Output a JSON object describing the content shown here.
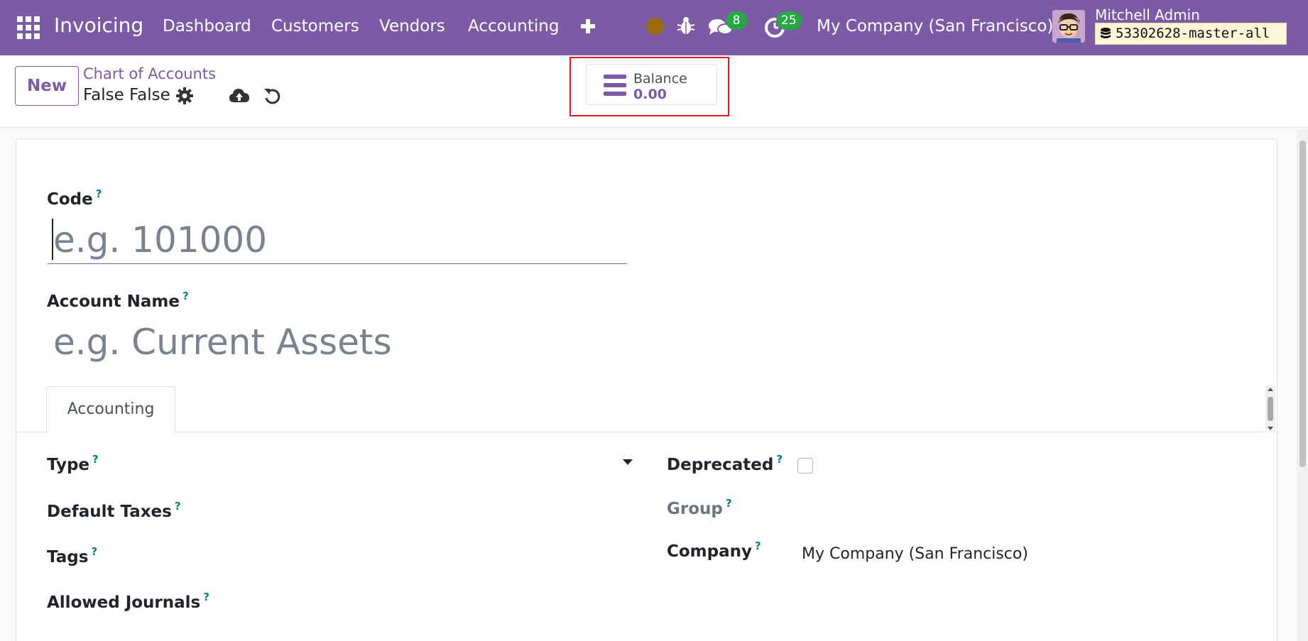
{
  "navbar": {
    "app_name": "Invoicing",
    "menu": [
      "Dashboard",
      "Customers",
      "Vendors",
      "Accounting"
    ],
    "messages_count": "8",
    "activities_count": "25",
    "company": "My Company (San Francisco)",
    "user": "Mitchell Admin",
    "database": "53302628-master-all"
  },
  "control": {
    "new_label": "New",
    "breadcrumb": "Chart of Accounts",
    "record_title": "False False",
    "stat_label": "Balance",
    "stat_value": "0.00"
  },
  "form": {
    "code_label": "Code",
    "code_placeholder": "e.g. 101000",
    "name_label": "Account Name",
    "name_placeholder": "e.g. Current Assets",
    "tab_label": "Accounting",
    "type_label": "Type",
    "default_taxes_label": "Default Taxes",
    "tags_label": "Tags",
    "allowed_journals_label": "Allowed Journals",
    "deprecated_label": "Deprecated",
    "group_label": "Group",
    "company_label": "Company",
    "company_value": "My Company (San Francisco)",
    "help_mark": "?"
  },
  "colors": {
    "brand": "#7c5aa6",
    "badge": "#28a745",
    "highlight": "#e0191f"
  }
}
